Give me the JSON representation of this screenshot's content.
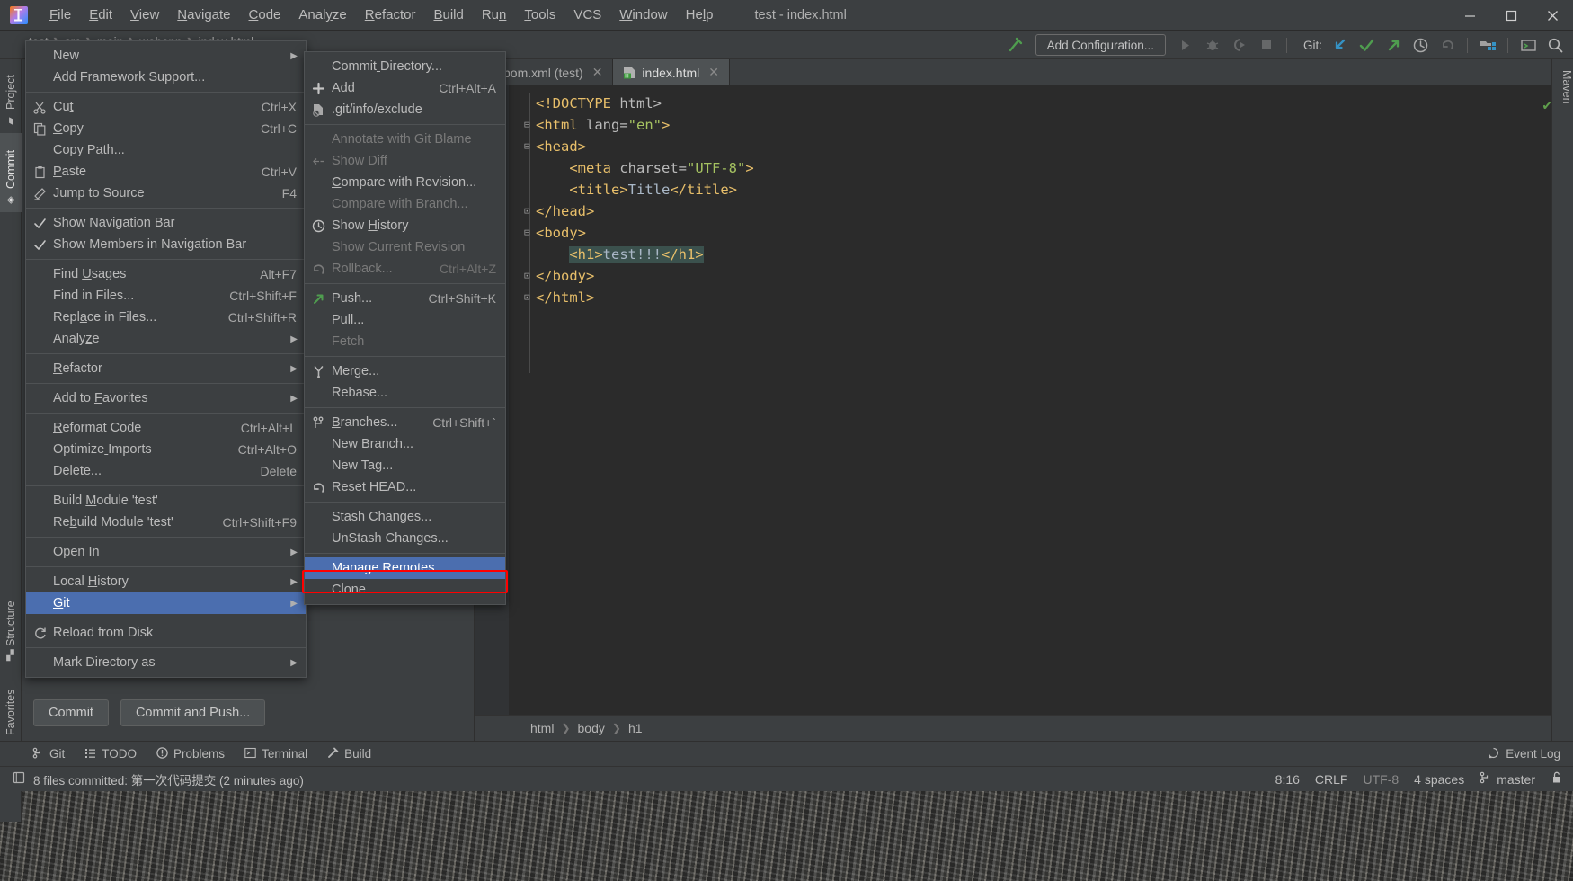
{
  "window": {
    "title": "test - index.html",
    "logo_icon": "intellij-idea-logo",
    "minimize_icon": "minimize-icon",
    "maximize_icon": "maximize-icon",
    "close_icon": "close-icon"
  },
  "menubar": [
    {
      "label": "File"
    },
    {
      "label": "Edit"
    },
    {
      "label": "View"
    },
    {
      "label": "Navigate"
    },
    {
      "label": "Code"
    },
    {
      "label": "Analyze"
    },
    {
      "label": "Refactor"
    },
    {
      "label": "Build"
    },
    {
      "label": "Run"
    },
    {
      "label": "Tools"
    },
    {
      "label": "VCS"
    },
    {
      "label": "Window"
    },
    {
      "label": "Help"
    }
  ],
  "navbar": {
    "items": [
      "test",
      "src",
      "main",
      "webapp",
      "index.html"
    ]
  },
  "toolbar": {
    "build_icon": "hammer-icon",
    "add_configuration": "Add Configuration...",
    "run_icon": "run-icon",
    "debug_icon": "debug-icon",
    "run_coverage_icon": "run-with-coverage-icon",
    "stop_icon": "stop-icon",
    "git_label": "Git:",
    "update_icon": "git-update-icon",
    "commit_icon": "git-commit-icon",
    "push_icon": "git-push-icon",
    "history_icon": "history-icon",
    "undo_icon": "undo-icon",
    "project_structure_icon": "project-structure-icon",
    "terminal_icon": "terminal-icon",
    "search_icon": "search-everywhere-icon"
  },
  "left_tool_strip": [
    {
      "label": "Project",
      "icon": "folder-icon",
      "selected": false
    },
    {
      "label": "Commit",
      "icon": "commit-icon",
      "selected": true
    },
    {
      "label": "Structure",
      "icon": "structure-icon",
      "selected": false
    },
    {
      "label": "Favorites",
      "icon": "star-icon",
      "selected": false
    }
  ],
  "right_tool_strip": [
    {
      "label": "Maven",
      "icon": "maven-icon"
    }
  ],
  "commit_panel": {
    "commit_button": "Commit",
    "commit_and_push_button": "Commit and Push..."
  },
  "editor_tabs": [
    {
      "label": "pom.xml (test)",
      "icon": "maven-file-icon",
      "active": false,
      "close_icon": "close-tab-icon"
    },
    {
      "label": "index.html",
      "icon": "html-file-icon",
      "active": true,
      "close_icon": "close-tab-icon"
    }
  ],
  "code": {
    "inspection_status_icon": "inspection-ok-icon",
    "lines": [
      {
        "fold": "",
        "segments": [
          {
            "t": "<!DOCTYPE ",
            "c": "tok-dt"
          },
          {
            "t": "html>",
            "c": "tok-attr"
          }
        ]
      },
      {
        "fold": "-",
        "segments": [
          {
            "t": "<html ",
            "c": "tok-tag"
          },
          {
            "t": "lang=",
            "c": "tok-attr"
          },
          {
            "t": "\"en\"",
            "c": "tok-str"
          },
          {
            "t": ">",
            "c": "tok-tag"
          }
        ]
      },
      {
        "fold": "-",
        "segments": [
          {
            "t": "<head>",
            "c": "tok-tag"
          }
        ]
      },
      {
        "fold": "",
        "segments": [
          {
            "t": "    <meta ",
            "c": "tok-tag"
          },
          {
            "t": "charset=",
            "c": "tok-attr"
          },
          {
            "t": "\"UTF-8\"",
            "c": "tok-str"
          },
          {
            "t": ">",
            "c": "tok-tag"
          }
        ]
      },
      {
        "fold": "",
        "segments": [
          {
            "t": "    <title>",
            "c": "tok-tag"
          },
          {
            "t": "Title",
            "c": "tok-txt"
          },
          {
            "t": "</title>",
            "c": "tok-tag"
          }
        ]
      },
      {
        "fold": "+",
        "segments": [
          {
            "t": "</head>",
            "c": "tok-tag"
          }
        ]
      },
      {
        "fold": "-",
        "segments": [
          {
            "t": "<body>",
            "c": "tok-tag"
          }
        ]
      },
      {
        "fold": "",
        "segments": [
          {
            "t": "    ",
            "c": "tok-txt"
          },
          {
            "t": "<h1>",
            "c": "tok-tag hl"
          },
          {
            "t": "test!!!",
            "c": "tok-txt hl"
          },
          {
            "t": "</h1>",
            "c": "tok-tag hl"
          }
        ]
      },
      {
        "fold": "+",
        "segments": [
          {
            "t": "</body>",
            "c": "tok-tag"
          }
        ]
      },
      {
        "fold": "+",
        "segments": [
          {
            "t": "</html>",
            "c": "tok-tag"
          }
        ]
      }
    ]
  },
  "breadcrumbs": [
    "html",
    "body",
    "h1"
  ],
  "bottom_toolbar": [
    {
      "label": "Git",
      "icon": "git-branch-icon"
    },
    {
      "label": "TODO",
      "icon": "todo-list-icon"
    },
    {
      "label": "Problems",
      "icon": "problems-icon"
    },
    {
      "label": "Terminal",
      "icon": "terminal-icon"
    },
    {
      "label": "Build",
      "icon": "build-hammer-icon"
    }
  ],
  "event_log": {
    "label": "Event Log",
    "icon": "event-log-icon"
  },
  "statusbar": {
    "message_icon": "notification-icon",
    "message": "8 files committed: 第一次代码提交 (2 minutes ago)",
    "caret": "8:16",
    "line_separator": "CRLF",
    "encoding": "UTF-8",
    "indent": "4 spaces",
    "branch_icon": "git-branch-icon",
    "branch": "master",
    "lock_icon": "unlocked-icon"
  },
  "context_menu": {
    "items": [
      {
        "label": "New",
        "icon": "",
        "accel": "",
        "arrow": true,
        "kind": "item"
      },
      {
        "label": "Add Framework Support...",
        "icon": "",
        "accel": "",
        "kind": "item"
      },
      {
        "kind": "sep"
      },
      {
        "label": "Cut",
        "icon": "scissors-icon",
        "accel": "Ctrl+X",
        "kind": "item"
      },
      {
        "label": "Copy",
        "icon": "copy-icon",
        "accel": "Ctrl+C",
        "kind": "item"
      },
      {
        "label": "Copy Path...",
        "icon": "",
        "accel": "",
        "kind": "item"
      },
      {
        "label": "Paste",
        "icon": "clipboard-icon",
        "accel": "Ctrl+V",
        "kind": "item"
      },
      {
        "label": "Jump to Source",
        "icon": "pencil-icon",
        "accel": "F4",
        "kind": "item"
      },
      {
        "kind": "sep"
      },
      {
        "label": "Show Navigation Bar",
        "icon": "checkmark-icon",
        "accel": "",
        "kind": "item"
      },
      {
        "label": "Show Members in Navigation Bar",
        "icon": "checkmark-icon",
        "accel": "",
        "kind": "item"
      },
      {
        "kind": "sep"
      },
      {
        "label": "Find Usages",
        "icon": "",
        "accel": "Alt+F7",
        "kind": "item"
      },
      {
        "label": "Find in Files...",
        "icon": "",
        "accel": "Ctrl+Shift+F",
        "kind": "item"
      },
      {
        "label": "Replace in Files...",
        "icon": "",
        "accel": "Ctrl+Shift+R",
        "kind": "item"
      },
      {
        "label": "Analyze",
        "icon": "",
        "accel": "",
        "arrow": true,
        "kind": "item"
      },
      {
        "kind": "sep"
      },
      {
        "label": "Refactor",
        "icon": "",
        "accel": "",
        "arrow": true,
        "kind": "item"
      },
      {
        "kind": "sep"
      },
      {
        "label": "Add to Favorites",
        "icon": "",
        "accel": "",
        "arrow": true,
        "kind": "item"
      },
      {
        "kind": "sep"
      },
      {
        "label": "Reformat Code",
        "icon": "",
        "accel": "Ctrl+Alt+L",
        "kind": "item"
      },
      {
        "label": "Optimize Imports",
        "icon": "",
        "accel": "Ctrl+Alt+O",
        "kind": "item"
      },
      {
        "label": "Delete...",
        "icon": "",
        "accel": "Delete",
        "kind": "item"
      },
      {
        "kind": "sep"
      },
      {
        "label": "Build Module 'test'",
        "icon": "",
        "accel": "",
        "kind": "item"
      },
      {
        "label": "Rebuild Module 'test'",
        "icon": "",
        "accel": "Ctrl+Shift+F9",
        "kind": "item"
      },
      {
        "kind": "sep"
      },
      {
        "label": "Open In",
        "icon": "",
        "accel": "",
        "arrow": true,
        "kind": "item"
      },
      {
        "kind": "sep"
      },
      {
        "label": "Local History",
        "icon": "",
        "accel": "",
        "arrow": true,
        "kind": "item"
      },
      {
        "label": "Git",
        "icon": "",
        "accel": "",
        "arrow": true,
        "kind": "item",
        "selected": true
      },
      {
        "kind": "sep"
      },
      {
        "label": "Reload from Disk",
        "icon": "refresh-icon",
        "accel": "",
        "kind": "item"
      },
      {
        "kind": "sep"
      },
      {
        "label": "Mark Directory as",
        "icon": "",
        "accel": "",
        "arrow": true,
        "kind": "item"
      }
    ]
  },
  "git_submenu": {
    "items": [
      {
        "label": "Commit Directory...",
        "icon": "",
        "accel": "",
        "kind": "item"
      },
      {
        "label": "Add",
        "icon": "plus-icon",
        "accel": "Ctrl+Alt+A",
        "kind": "item"
      },
      {
        "label": ".git/info/exclude",
        "icon": "ignore-file-icon",
        "accel": "",
        "kind": "item"
      },
      {
        "kind": "sep"
      },
      {
        "label": "Annotate with Git Blame",
        "icon": "",
        "accel": "",
        "kind": "item",
        "disabled": true
      },
      {
        "label": "Show Diff",
        "icon": "diff-icon",
        "accel": "",
        "kind": "item",
        "disabled": true
      },
      {
        "label": "Compare with Revision...",
        "icon": "",
        "accel": "",
        "kind": "item"
      },
      {
        "label": "Compare with Branch...",
        "icon": "",
        "accel": "",
        "kind": "item",
        "disabled": true
      },
      {
        "label": "Show History",
        "icon": "clock-icon",
        "accel": "",
        "kind": "item"
      },
      {
        "label": "Show Current Revision",
        "icon": "",
        "accel": "",
        "kind": "item",
        "disabled": true
      },
      {
        "label": "Rollback...",
        "icon": "rollback-icon",
        "accel": "Ctrl+Alt+Z",
        "kind": "item",
        "disabled": true
      },
      {
        "kind": "sep"
      },
      {
        "label": "Push...",
        "icon": "push-arrow-icon",
        "accel": "Ctrl+Shift+K",
        "kind": "item"
      },
      {
        "label": "Pull...",
        "icon": "",
        "accel": "",
        "kind": "item"
      },
      {
        "label": "Fetch",
        "icon": "",
        "accel": "",
        "kind": "item",
        "disabled": true
      },
      {
        "kind": "sep"
      },
      {
        "label": "Merge...",
        "icon": "merge-icon",
        "accel": "",
        "kind": "item"
      },
      {
        "label": "Rebase...",
        "icon": "",
        "accel": "",
        "kind": "item"
      },
      {
        "kind": "sep"
      },
      {
        "label": "Branches...",
        "icon": "branch-icon",
        "accel": "Ctrl+Shift+`",
        "kind": "item"
      },
      {
        "label": "New Branch...",
        "icon": "",
        "accel": "",
        "kind": "item"
      },
      {
        "label": "New Tag...",
        "icon": "",
        "accel": "",
        "kind": "item"
      },
      {
        "label": "Reset HEAD...",
        "icon": "reset-icon",
        "accel": "",
        "kind": "item"
      },
      {
        "kind": "sep"
      },
      {
        "label": "Stash Changes...",
        "icon": "",
        "accel": "",
        "kind": "item"
      },
      {
        "label": "UnStash Changes...",
        "icon": "",
        "accel": "",
        "kind": "item"
      },
      {
        "kind": "sep"
      },
      {
        "label": "Manage Remotes...",
        "icon": "",
        "accel": "",
        "kind": "item",
        "selected": true,
        "highlighted": true
      },
      {
        "label": "Clone...",
        "icon": "",
        "accel": "",
        "kind": "item"
      }
    ]
  },
  "colors": {
    "selection_blue": "#4b6eaf",
    "highlight_red": "#ff0000",
    "accent_green": "#4f9d4f",
    "accent_blue": "#3592c4",
    "panel_bg": "#3c3f41",
    "editor_bg": "#2b2b2b"
  }
}
